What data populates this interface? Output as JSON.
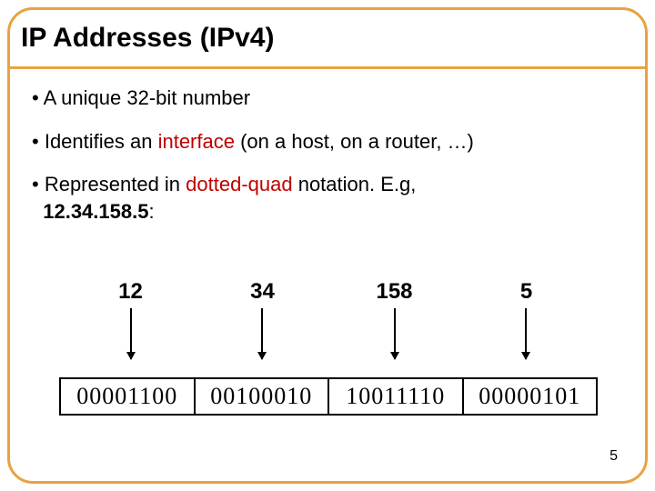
{
  "title": "IP Addresses (IPv4)",
  "bullets": {
    "b1": "A unique 32-bit number",
    "b2_a": "Identifies an ",
    "b2_interface": "interface",
    "b2_b": " (on a host, on a router, …)",
    "b3_a": "Represented in ",
    "b3_dq": "dotted-quad",
    "b3_b": " notation.  E.g, ",
    "b3_ex": "12.34.158.5",
    "b3_c": ":"
  },
  "quad": {
    "q1": "12",
    "q2": "34",
    "q3": "158",
    "q4": "5"
  },
  "bin": {
    "b1": "00001100",
    "b2": "00100010",
    "b3": "10011110",
    "b4": "00000101"
  },
  "page_number": "5"
}
